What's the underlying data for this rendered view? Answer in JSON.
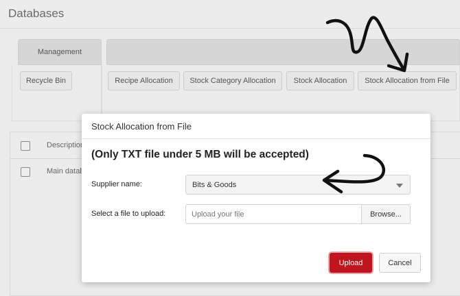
{
  "page": {
    "title": "Databases"
  },
  "groups": {
    "management": {
      "header": "Management",
      "buttons": {
        "recycle_bin": "Recycle Bin"
      }
    },
    "allocation": {
      "header": "",
      "buttons": {
        "recipe_allocation": "Recipe Allocation",
        "stock_category_allocation": "Stock Category Allocation",
        "stock_allocation": "Stock Allocation",
        "stock_allocation_from_file": "Stock Allocation from File"
      }
    }
  },
  "grid": {
    "header": {
      "description": "Description"
    },
    "rows": [
      {
        "description": "Main datab"
      }
    ]
  },
  "modal": {
    "title": "Stock Allocation from File",
    "notice": "(Only TXT file under 5 MB will be accepted)",
    "supplier_label": "Supplier name:",
    "supplier_value": "Bits & Goods",
    "file_label": "Select a file to upload:",
    "file_placeholder": "Upload your file",
    "browse_label": "Browse...",
    "upload_label": "Upload",
    "cancel_label": "Cancel"
  },
  "colors": {
    "upload_button": "#c0141f",
    "background": "#ececec",
    "annotation_ink": "#111111"
  }
}
